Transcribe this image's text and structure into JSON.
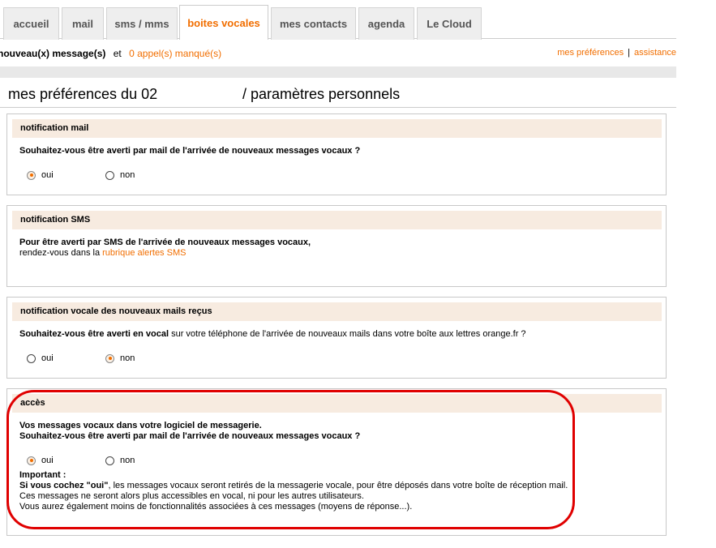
{
  "tabs": [
    {
      "label": "accueil"
    },
    {
      "label": "mail"
    },
    {
      "label": "sms / mms"
    },
    {
      "label": "boites vocales"
    },
    {
      "label": "mes contacts"
    },
    {
      "label": "agenda"
    },
    {
      "label": "Le Cloud"
    }
  ],
  "status": {
    "new_messages": "nouveau(x) message(s)",
    "et": "et",
    "missed_calls": "0 appel(s) manqué(s)"
  },
  "toplinks": {
    "preferences": "mes préférences",
    "separator": "|",
    "assistance": "assistance"
  },
  "page": {
    "title_left": "mes préférences du 02",
    "title_right": "/ paramètres personnels"
  },
  "panels": {
    "mail": {
      "heading": "notification mail",
      "question": "Souhaitez-vous être averti par mail de l'arrivée de nouveaux messages vocaux ?",
      "yes": "oui",
      "no": "non",
      "selected": "oui"
    },
    "sms": {
      "heading": "notification SMS",
      "line1": "Pour être averti par SMS de l'arrivée de nouveaux messages vocaux,",
      "line2_prefix": "rendez-vous dans la",
      "line2_link": "rubrique alertes SMS"
    },
    "vocal": {
      "heading": "notification vocale des nouveaux mails reçus",
      "question_bold": "Souhaitez-vous être averti en vocal",
      "question_rest": "sur votre téléphone de l'arrivée de nouveaux mails dans votre boîte aux lettres orange.fr ?",
      "yes": "oui",
      "no": "non",
      "selected": "non"
    },
    "acces": {
      "heading": "accès",
      "line1": "Vos messages vocaux dans votre logiciel de messagerie.",
      "line2": "Souhaitez-vous être averti par mail de l'arrivée de nouveaux messages vocaux ?",
      "yes": "oui",
      "no": "non",
      "selected": "oui",
      "important_label": "Important :",
      "note1_bold": "Si vous cochez \"oui\"",
      "note1_rest": ", les messages vocaux seront retirés de la messagerie vocale, pour être déposés dans votre boîte de réception mail.",
      "note2": "Ces messages ne seront alors plus accessibles en vocal, ni pour les autres utilisateurs.",
      "note3": "Vous aurez également moins de fonctionnalités associées à ces messages (moyens de réponse...)."
    }
  },
  "colors": {
    "accent": "#f16e00",
    "panel_header": "#f7ebe0",
    "annotation": "#e00000"
  }
}
